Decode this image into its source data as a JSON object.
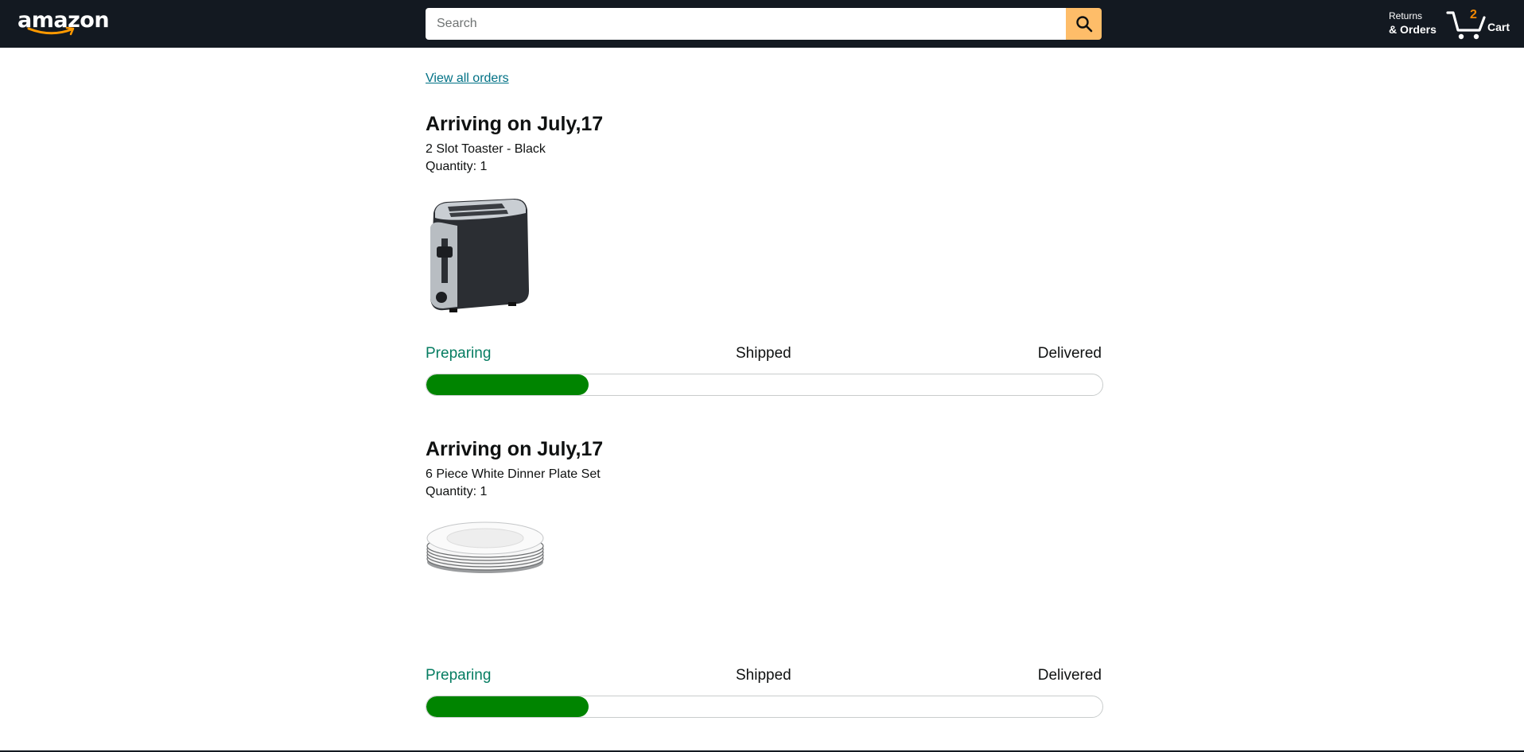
{
  "header": {
    "logo_text": "amazon",
    "search": {
      "placeholder": "Search",
      "value": ""
    },
    "returns_line1": "Returns",
    "returns_line2": "& Orders",
    "cart_count": "2",
    "cart_label": "Cart"
  },
  "main": {
    "view_all_orders": "View all orders",
    "orders": [
      {
        "title": "Arriving on July,17",
        "item_name": "2 Slot Toaster - Black",
        "quantity": "Quantity: 1",
        "image_icon": "toaster-image",
        "stages": [
          "Preparing",
          "Shipped",
          "Delivered"
        ],
        "active_stage": 0,
        "progress_fraction": 0.24
      },
      {
        "title": "Arriving on July,17",
        "item_name": "6 Piece White Dinner Plate Set",
        "quantity": "Quantity: 1",
        "image_icon": "dinner-plates-image",
        "stages": [
          "Preparing",
          "Shipped",
          "Delivered"
        ],
        "active_stage": 0,
        "progress_fraction": 0.24
      }
    ]
  },
  "colors": {
    "header_bg": "#131921",
    "search_button": "#febd69",
    "link": "#007185",
    "active_stage": "#067d62",
    "progress_fill": "#008400",
    "cart_count": "#f08804"
  }
}
